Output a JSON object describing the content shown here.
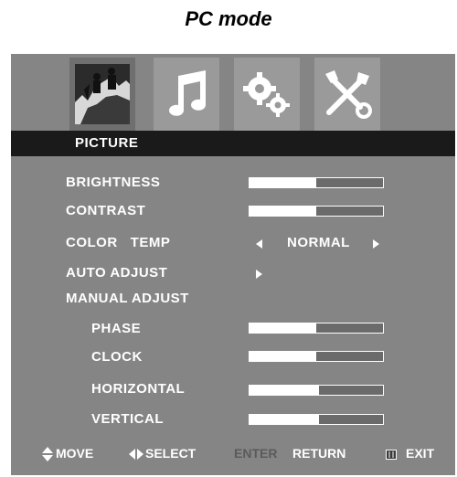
{
  "caption": "PC mode",
  "tabs": [
    {
      "name": "picture",
      "icon": "picture-icon",
      "active": true
    },
    {
      "name": "sound",
      "icon": "music-note-icon",
      "active": false
    },
    {
      "name": "options",
      "icon": "gears-icon",
      "active": false
    },
    {
      "name": "setup",
      "icon": "tools-icon",
      "active": false
    }
  ],
  "menu_title": "PICTURE",
  "items": {
    "brightness": {
      "label": "BRIGHTNESS",
      "level": 0.5
    },
    "contrast": {
      "label": "CONTRAST",
      "level": 0.5
    },
    "color_temp": {
      "label": "COLOR   TEMP",
      "value": "NORMAL"
    },
    "auto_adjust": {
      "label": "AUTO ADJUST"
    },
    "manual_adjust": {
      "label": "MANUAL ADJUST"
    },
    "phase": {
      "label": "PHASE",
      "level": 0.5
    },
    "clock": {
      "label": "CLOCK",
      "level": 0.5
    },
    "horizontal": {
      "label": "HORIZONTAL",
      "level": 0.52
    },
    "vertical": {
      "label": "VERTICAL",
      "level": 0.52
    }
  },
  "footer": {
    "move": "MOVE",
    "select": "SELECT",
    "enter": "ENTER",
    "return": "RETURN",
    "exit": "EXIT"
  },
  "colors": {
    "panel": "#858585",
    "titlebar": "#1a1a1a",
    "text": "#ffffff",
    "dim_text": "#5b5b5b"
  }
}
